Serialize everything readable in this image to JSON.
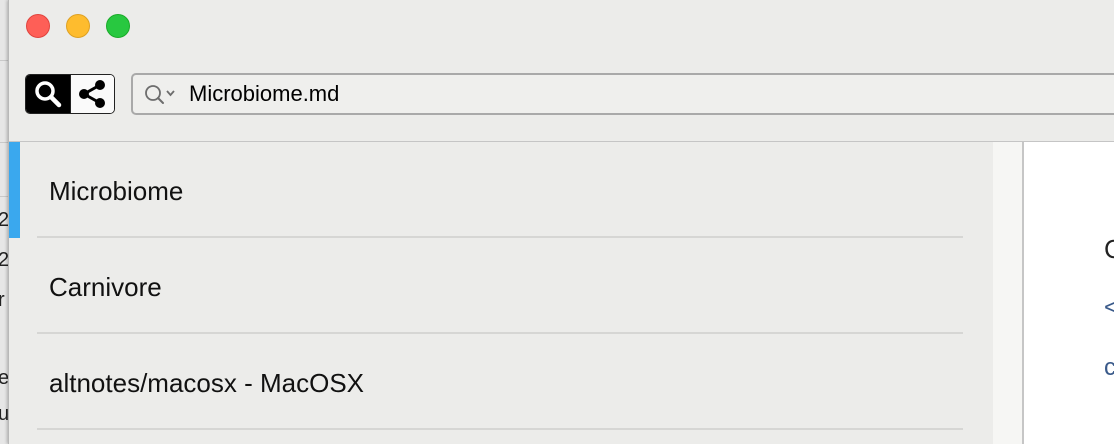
{
  "window": {
    "traffic_lights": [
      {
        "name": "close",
        "color": "#fe5f57"
      },
      {
        "name": "minimize",
        "color": "#febc2e"
      },
      {
        "name": "maximize",
        "color": "#28c840"
      }
    ]
  },
  "toolbar": {
    "search_mode_icon": "magnifier-icon",
    "share_icon": "share-icon",
    "search": {
      "icon": "search-dropdown-icon",
      "value": "Microbiome.md"
    }
  },
  "notes": {
    "selected_index": 0,
    "accent_color": "#3aa8ee",
    "items": [
      {
        "title": "Microbiome"
      },
      {
        "title": "Carnivore"
      },
      {
        "title": "altnotes/macosx - MacOSX"
      }
    ]
  },
  "editor": {
    "fragments": [
      "C",
      "<",
      "c"
    ]
  },
  "background_window": {
    "fragments": [
      "2",
      "2",
      "r",
      "e",
      "u"
    ]
  }
}
